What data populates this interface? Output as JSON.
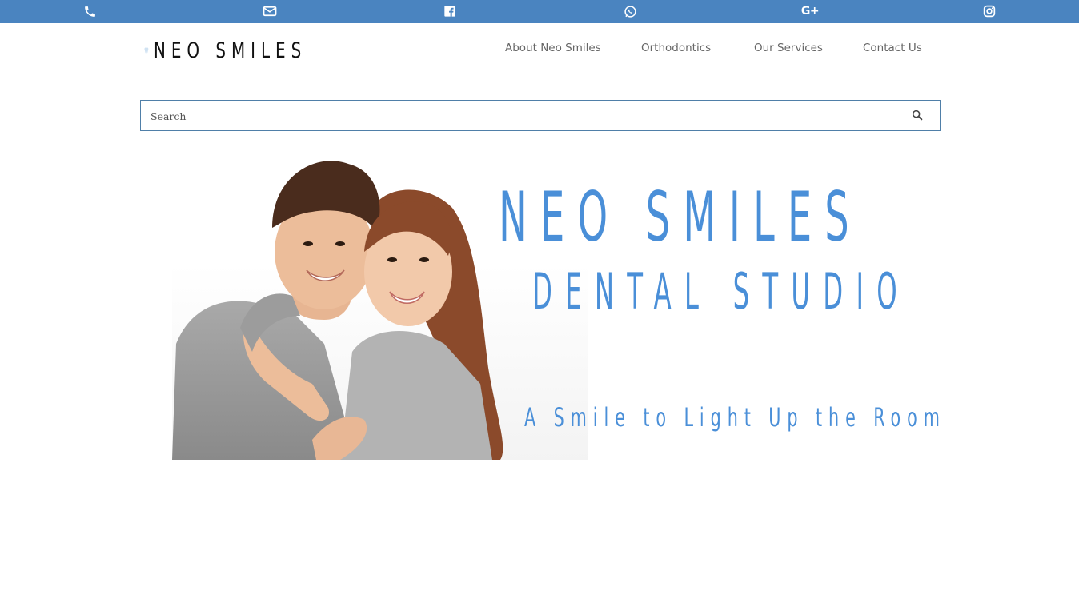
{
  "topbar": {
    "background": "#4a84c0",
    "icons": [
      "phone-icon",
      "envelope-icon",
      "facebook-icon",
      "whatsapp-icon",
      "google-plus-icon",
      "instagram-icon"
    ],
    "google_plus_label": "G+"
  },
  "logo": {
    "text": "NEO SMILES",
    "icon": "tooth-icon"
  },
  "nav": {
    "items": [
      "About Neo Smiles",
      "Orthodontics",
      "Our Services",
      "Contact Us"
    ]
  },
  "search": {
    "placeholder": "Search",
    "button_icon": "search-icon"
  },
  "hero": {
    "title": "NEO SMILES",
    "subtitle": "DENTAL STUDIO",
    "tagline": "A Smile to Light Up the Room",
    "accent": "#4a8fd8"
  }
}
